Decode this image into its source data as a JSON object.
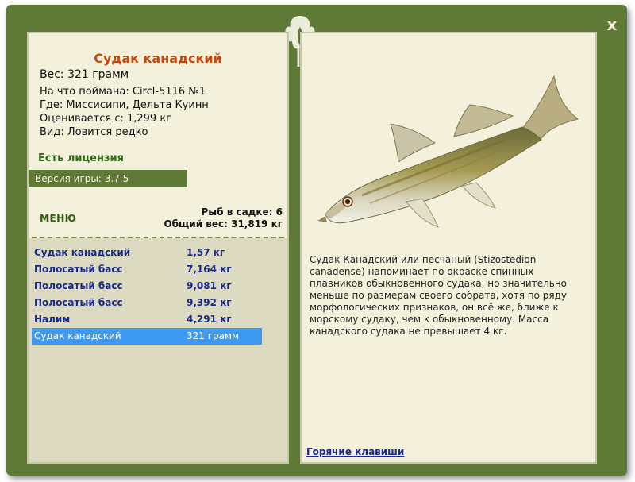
{
  "window": {
    "close_label": "x"
  },
  "left": {
    "fish_title": "Судак канадский",
    "weight_label": "Вес: 321 грамм",
    "info": [
      "На что поймана: Circl-5116 №1",
      "Где: Миссисипи, Дельта Куинн",
      "Оценивается с: 1,299 кг",
      "Вид: Ловится редко"
    ],
    "license": "Есть лицензия",
    "version": "Версия игры: 3.7.5",
    "menu_label": "МЕНЮ",
    "cage_count": "Рыб в садке: 6",
    "total_weight": "Общий вес: 31,819 кг",
    "catch_list": [
      {
        "name": "Судак канадский",
        "weight": "1,57 кг",
        "selected": false
      },
      {
        "name": "Полосатый басс",
        "weight": "7,164 кг",
        "selected": false
      },
      {
        "name": "Полосатый басс",
        "weight": "9,081 кг",
        "selected": false
      },
      {
        "name": "Полосатый басс",
        "weight": "9,392 кг",
        "selected": false
      },
      {
        "name": "Налим",
        "weight": "4,291 кг",
        "selected": false
      },
      {
        "name": "Судак канадский",
        "weight": "321 грамм",
        "selected": true
      }
    ]
  },
  "right": {
    "description": "Судак Канадский или песчаный (Stizostedion canadense) напоминает по окраске спинных плавников обыкновенного судака, но значительно меньше по размерам своего собрата, хотя по ряду морфологических признаков, он всё же, ближе к морскому судаку, чем к обыкновенному. Масса канадского судака не превышает 4 кг.",
    "hotkeys_label": "Горячие клавиши"
  },
  "colors": {
    "frame": "#5f7a37",
    "panel": "#f3f1dc",
    "title": "#c04a10",
    "license": "#2f6b12",
    "list_text": "#1a2a8a",
    "selection": "#3d9af0"
  }
}
